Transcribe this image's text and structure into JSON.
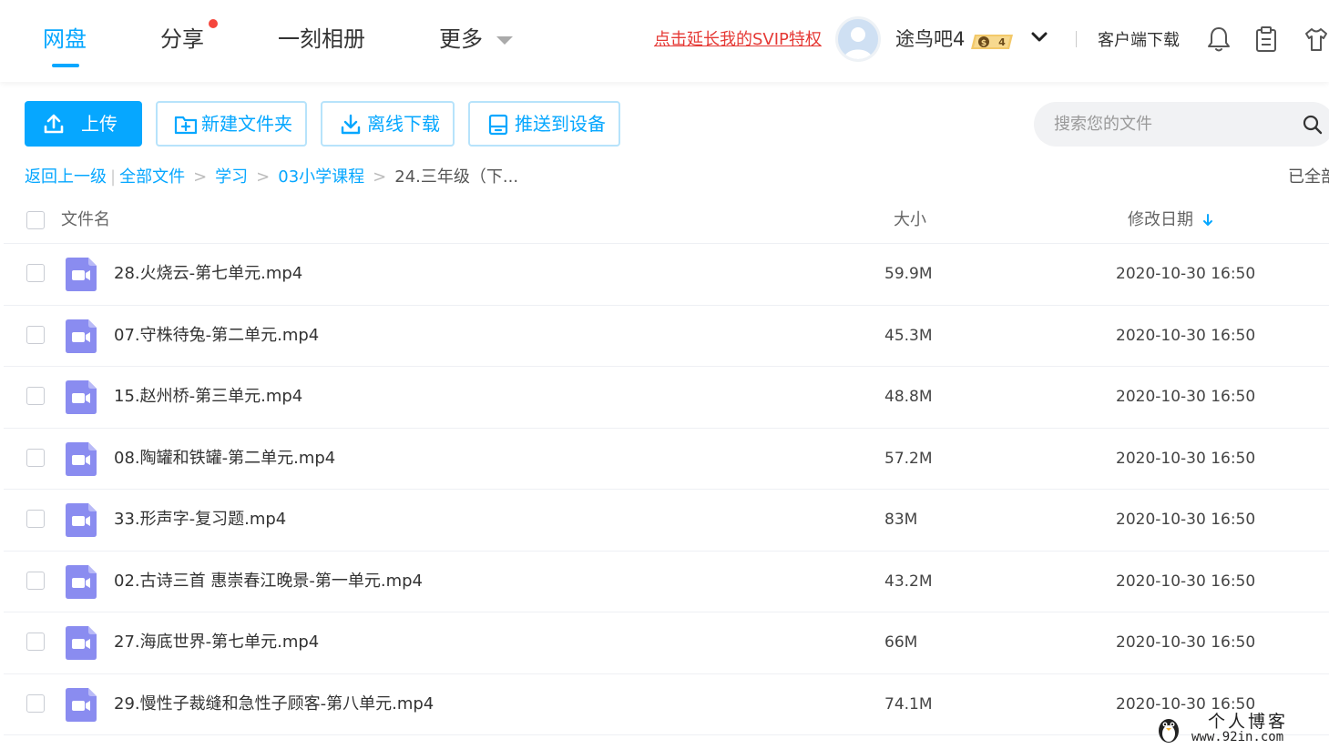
{
  "nav": {
    "tabs": [
      {
        "label": "网盘",
        "active": true
      },
      {
        "label": "分享",
        "has_dot": true
      },
      {
        "label": "一刻相册"
      },
      {
        "label": "更多"
      }
    ],
    "svip_link": "点击延长我的SVIP特权",
    "username": "途鸟吧4",
    "vip_level": "4",
    "client_download": "客户端下载",
    "icons": [
      "bell-icon",
      "clipboard-icon",
      "shirt-icon"
    ]
  },
  "toolbar": {
    "upload": "上传",
    "new_folder": "新建文件夹",
    "offline_download": "离线下载",
    "push_device": "推送到设备"
  },
  "search": {
    "placeholder": "搜索您的文件"
  },
  "breadcrumb": {
    "back": "返回上一级",
    "items": [
      "全部文件",
      "学习",
      "03小学课程"
    ],
    "current": "24.三年级（下..."
  },
  "loaded_text": "已全部",
  "table": {
    "headers": {
      "name": "文件名",
      "size": "大小",
      "date": "修改日期"
    },
    "sort": {
      "column": "date",
      "direction": "desc"
    },
    "rows": [
      {
        "name": "28.火烧云-第七单元.mp4",
        "size": "59.9M",
        "date": "2020-10-30 16:50"
      },
      {
        "name": "07.守株待兔-第二单元.mp4",
        "size": "45.3M",
        "date": "2020-10-30 16:50"
      },
      {
        "name": "15.赵州桥-第三单元.mp4",
        "size": "48.8M",
        "date": "2020-10-30 16:50"
      },
      {
        "name": "08.陶罐和铁罐-第二单元.mp4",
        "size": "57.2M",
        "date": "2020-10-30 16:50"
      },
      {
        "name": "33.形声字-复习题.mp4",
        "size": "83M",
        "date": "2020-10-30 16:50"
      },
      {
        "name": "02.古诗三首 惠崇春江晚景-第一单元.mp4",
        "size": "43.2M",
        "date": "2020-10-30 16:50"
      },
      {
        "name": "27.海底世界-第七单元.mp4",
        "size": "66M",
        "date": "2020-10-30 16:50"
      },
      {
        "name": "29.慢性子裁缝和急性子顾客-第八单元.mp4",
        "size": "74.1M",
        "date": "2020-10-30 16:50"
      }
    ]
  },
  "watermark": {
    "title": "个人博客",
    "url": "www.92in.com"
  },
  "colors": {
    "accent": "#06a7ff",
    "alert": "#e53935",
    "video_icon": "#8a8cf0"
  }
}
